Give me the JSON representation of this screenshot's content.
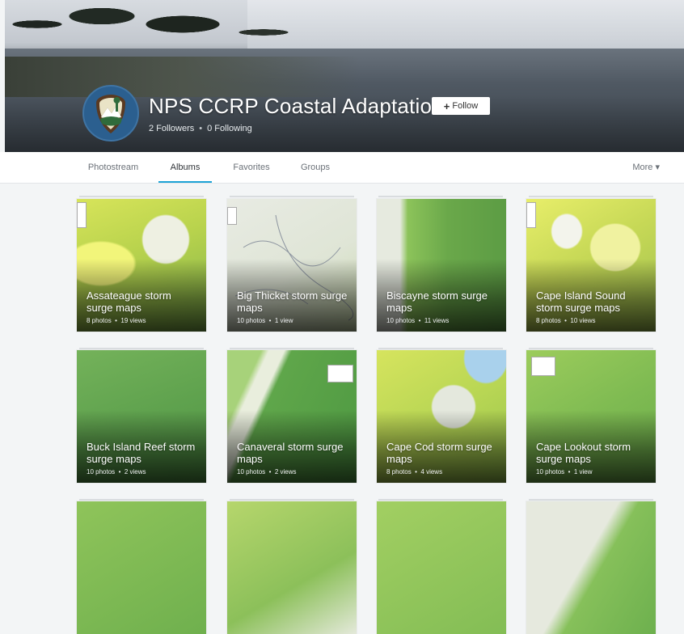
{
  "profile": {
    "name": "NPS CCRP Coastal Adaptation",
    "follow_label": "Follow",
    "followers": "2 Followers",
    "following": "0 Following"
  },
  "nav": {
    "tabs": [
      {
        "label": "Photostream",
        "active": false
      },
      {
        "label": "Albums",
        "active": true
      },
      {
        "label": "Favorites",
        "active": false
      },
      {
        "label": "Groups",
        "active": false
      }
    ],
    "more_label": "More"
  },
  "albums": [
    {
      "title": "Assateague storm surge maps",
      "photos": "8 photos",
      "views": "19 views"
    },
    {
      "title": "Big Thicket storm surge maps",
      "photos": "10 photos",
      "views": "1 view"
    },
    {
      "title": "Biscayne storm surge maps",
      "photos": "10 photos",
      "views": "11 views"
    },
    {
      "title": "Cape Island Sound storm surge maps",
      "photos": "8 photos",
      "views": "10 views"
    },
    {
      "title": "Buck Island Reef storm surge maps",
      "photos": "10 photos",
      "views": "2 views"
    },
    {
      "title": "Canaveral storm surge maps",
      "photos": "10 photos",
      "views": "2 views"
    },
    {
      "title": "Cape Cod storm surge maps",
      "photos": "8 photos",
      "views": "4 views"
    },
    {
      "title": "Cape Lookout storm surge maps",
      "photos": "10 photos",
      "views": "1 view"
    },
    {
      "title": "",
      "photos": "",
      "views": ""
    },
    {
      "title": "",
      "photos": "",
      "views": ""
    },
    {
      "title": "",
      "photos": "",
      "views": ""
    },
    {
      "title": "",
      "photos": "",
      "views": ""
    }
  ],
  "colors": {
    "accent": "#1ca3d6",
    "avatar_bg": "#2b5f8f",
    "page_bg": "#f3f5f6"
  }
}
